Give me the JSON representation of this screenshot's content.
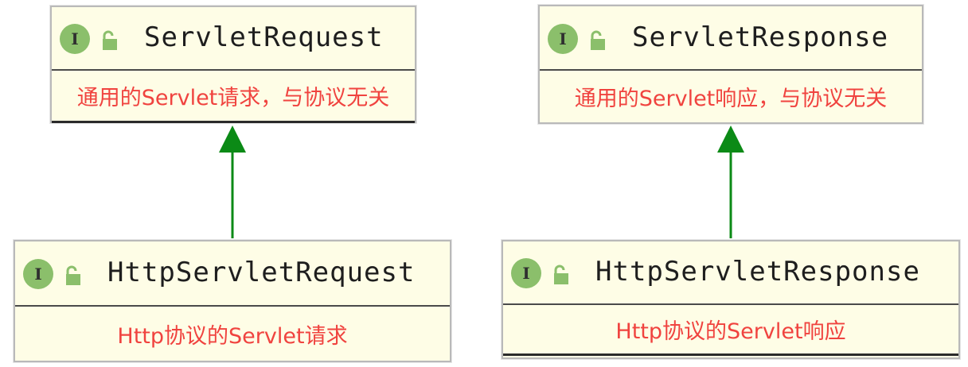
{
  "boxes": {
    "servlet_request": {
      "icon_letter": "I",
      "name": "ServletRequest",
      "description": "通用的Servlet请求，与协议无关"
    },
    "servlet_response": {
      "icon_letter": "I",
      "name": "ServletResponse",
      "description": "通用的Servlet响应，与协议无关"
    },
    "http_servlet_request": {
      "icon_letter": "I",
      "name": "HttpServletRequest",
      "description": "Http协议的Servlet请求"
    },
    "http_servlet_response": {
      "icon_letter": "I",
      "name": "HttpServletResponse",
      "description": "Http协议的Servlet响应"
    }
  },
  "icons": {
    "interface": "interface-icon",
    "visibility": "public-unlock-icon"
  },
  "colors": {
    "box_fill": "#fefde6",
    "interface_icon": "#8bbf6b",
    "description_text": "#f0433f",
    "arrow": "#0b8a16"
  }
}
